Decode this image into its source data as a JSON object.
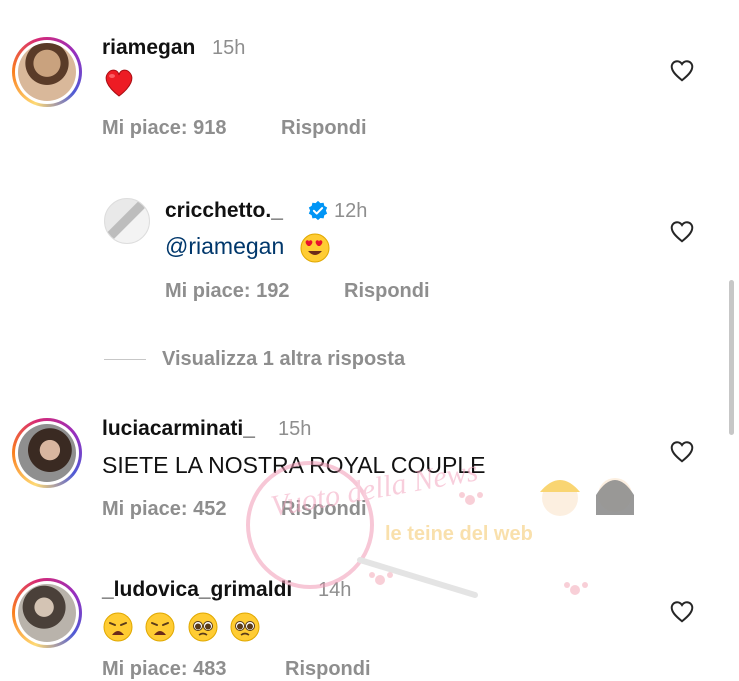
{
  "comments": [
    {
      "username": "riamegan",
      "time": "15h",
      "text": "",
      "emojis": [
        "red-heart"
      ],
      "likes_label": "Mi piace: 918",
      "reply_label": "Rispondi"
    },
    {
      "username": "cricchetto._",
      "time": "12h",
      "mention": "@riamegan",
      "emojis": [
        "heart-eyes"
      ],
      "likes_label": "Mi piace: 192",
      "reply_label": "Rispondi",
      "verified": true
    },
    {
      "username": "luciacarminati_",
      "time": "15h",
      "text": "SIETE LA NOSTRA ROYAL COUPLE",
      "likes_label": "Mi piace: 452",
      "reply_label": "Rispondi"
    },
    {
      "username": "_ludovica_grimaldi",
      "time": "14h",
      "text": "",
      "emojis": [
        "weary-face",
        "weary-face",
        "pleading-face",
        "pleading-face"
      ],
      "likes_label": "Mi piace: 483",
      "reply_label": "Rispondi"
    }
  ],
  "view_replies_label": "Visualizza 1 altra risposta",
  "watermark": {
    "text_1": "Vuoto della News",
    "text_2": "le teine del web"
  },
  "colors": {
    "muted": "#8e8e8e",
    "mention": "#00376b",
    "verified": "#0095f6",
    "heart": "#ed1c24"
  }
}
